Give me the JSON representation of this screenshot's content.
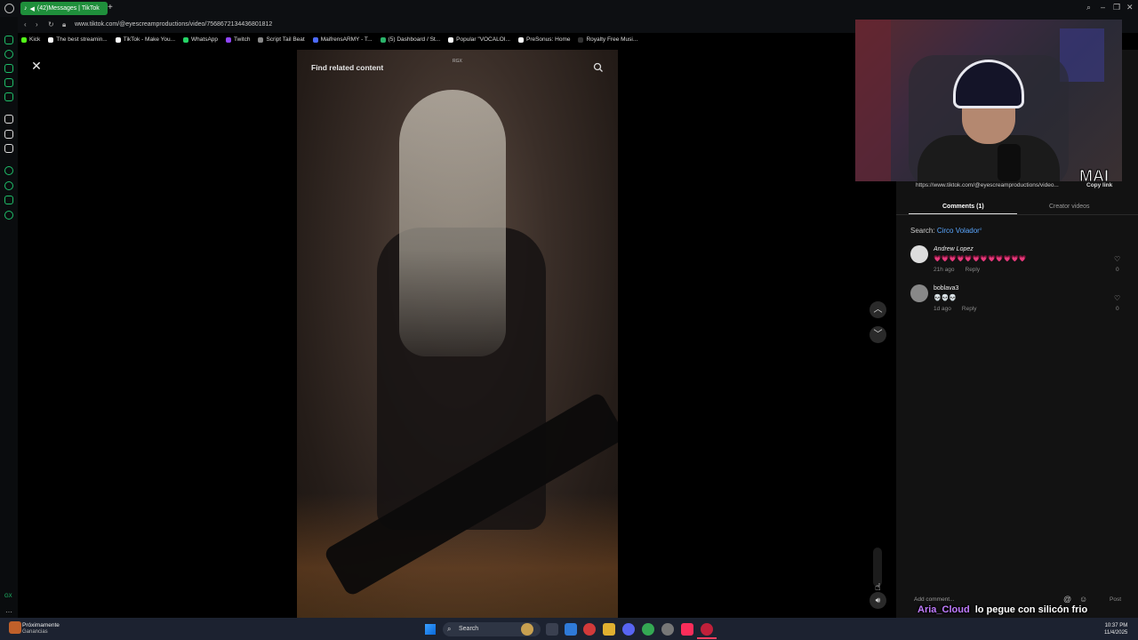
{
  "browser": {
    "tab_title": "(42)Messages | TikTok",
    "url": "www.tiktok.com/@eyescreamproductions/video/7568672134436801812",
    "bookmarks": [
      {
        "label": "Kick",
        "color": "#53fc18"
      },
      {
        "label": "The best streamin...",
        "color": "#ffffff"
      },
      {
        "label": "TikTok - Make You...",
        "color": "#ffffff"
      },
      {
        "label": "WhatsApp",
        "color": "#25d366"
      },
      {
        "label": "Twitch",
        "color": "#9146ff"
      },
      {
        "label": "Script Tail Beat",
        "color": "#888888"
      },
      {
        "label": "MaifrensARMY - T...",
        "color": "#4d6bff"
      },
      {
        "label": "(5) Dashboard / St...",
        "color": "#2ab36a"
      },
      {
        "label": "Popular \"VOCALOI...",
        "color": "#ffffff"
      },
      {
        "label": "PreSonus: Home",
        "color": "#ffffff"
      },
      {
        "label": "Royalty Free Musi...",
        "color": "#333333"
      }
    ]
  },
  "video": {
    "find_related": "Find related content",
    "watermark": "RGX"
  },
  "panel": {
    "link_url": "https://www.tiktok.com/@eyescreamproductions/video...",
    "copy_link": "Copy link",
    "tab_comments": "Comments (1)",
    "tab_creator": "Creator videos",
    "search_prefix": "Search:",
    "search_term": "Circo Volador",
    "comments": [
      {
        "name": "Andrew Lopez",
        "text": "💗💗💗💗💗💗💗💗💗💗💗💗",
        "age": "21h ago",
        "reply": "Reply",
        "likes": "0",
        "text_color": "#ff4fa3"
      },
      {
        "name": "boblava3",
        "text": "💀💀💀",
        "age": "1d ago",
        "reply": "Reply",
        "likes": "0",
        "text_color": "#dddddd"
      }
    ],
    "add_comment": "Add comment...",
    "post": "Post"
  },
  "webcam": {
    "logo": "MAI"
  },
  "chat": {
    "user": "Aria_Cloud",
    "message": "lo pegue con silicón frio"
  },
  "taskbar": {
    "weather_line1": "Próximamente",
    "weather_line2": "Ganancias",
    "search": "Search",
    "time": "10:37 PM",
    "date": "11/4/2025"
  }
}
